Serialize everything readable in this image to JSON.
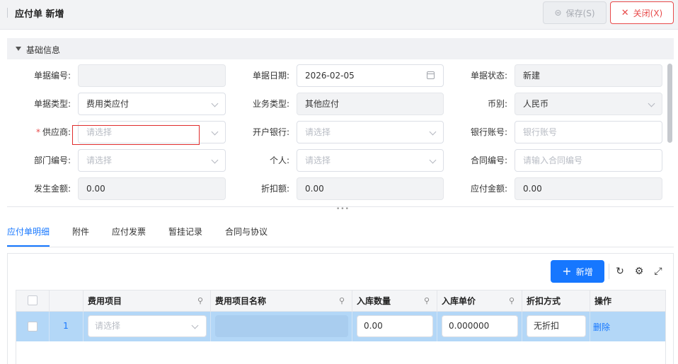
{
  "header": {
    "title": "应付单 新增",
    "save_label": "保存(S)",
    "close_label": "关闭(X)"
  },
  "section": {
    "title": "基础信息"
  },
  "form": {
    "doc_no": {
      "label": "单据编号:",
      "value": ""
    },
    "doc_date": {
      "label": "单据日期:",
      "value": "2026-02-05"
    },
    "doc_status": {
      "label": "单据状态:",
      "value": "新建"
    },
    "doc_type": {
      "label": "单据类型:",
      "value": "费用类应付"
    },
    "biz_type": {
      "label": "业务类型:",
      "value": "其他应付"
    },
    "currency": {
      "label": "币别:",
      "value": "人民币"
    },
    "supplier": {
      "label": "供应商:",
      "required_mark": "*",
      "placeholder": "请选择"
    },
    "bank": {
      "label": "开户银行:",
      "placeholder": "请选择"
    },
    "bank_account": {
      "label": "银行账号:",
      "placeholder": "银行账号"
    },
    "dept": {
      "label": "部门编号:",
      "placeholder": "请选择"
    },
    "person": {
      "label": "个人:",
      "placeholder": "请选择"
    },
    "contract": {
      "label": "合同编号:",
      "placeholder": "请输入合同编号"
    },
    "amount": {
      "label": "发生金额:",
      "value": "0.00"
    },
    "discount": {
      "label": "折扣额:",
      "value": "0.00"
    },
    "payable": {
      "label": "应付金额:",
      "value": "0.00"
    }
  },
  "tabs": [
    "应付单明细",
    "附件",
    "应付发票",
    "暂挂记录",
    "合同与协议"
  ],
  "toolbar": {
    "add_label": "新增"
  },
  "table": {
    "columns": [
      "费用项目",
      "费用项目名称",
      "入库数量",
      "入库单价",
      "折扣方式",
      "操作"
    ],
    "rows": [
      {
        "index": "1",
        "fee_item_placeholder": "请选择",
        "fee_item_name": "",
        "qty": "0.00",
        "price": "0.000000",
        "discount_mode": "无折扣",
        "action": "删除"
      }
    ]
  },
  "colors": {
    "primary": "#1677ff",
    "danger": "#e84a4a",
    "row_selected": "#b3d7f7"
  }
}
